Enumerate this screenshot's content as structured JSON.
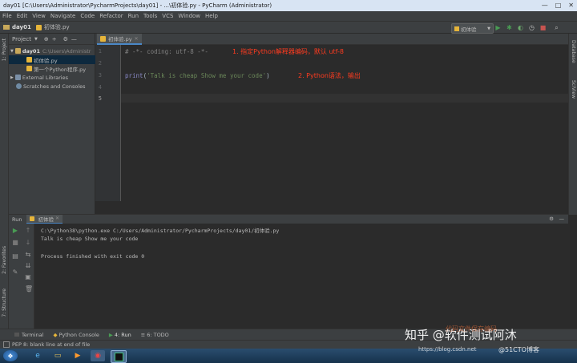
{
  "window": {
    "title": "day01 [C:\\Users\\Administrator\\PycharmProjects\\day01] - ...\\初体验.py - PyCharm (Administrator)",
    "controls": [
      "—",
      "□",
      "✕"
    ]
  },
  "menu": [
    "File",
    "Edit",
    "View",
    "Navigate",
    "Code",
    "Refactor",
    "Run",
    "Tools",
    "VCS",
    "Window",
    "Help"
  ],
  "breadcrumb": {
    "project": "day01",
    "file": "初体验.py"
  },
  "run_config": {
    "label": "初体验"
  },
  "left_tool_labels": {
    "project": "1: Project",
    "favorites": "2: Favorites",
    "structure": "7: Structure"
  },
  "right_tool_labels": {
    "database": "Database",
    "sciview": "SciView"
  },
  "project_panel": {
    "header_label": "Project",
    "tree": [
      {
        "label": "day01",
        "suffix": "C:\\Users\\Administr",
        "level": 0,
        "type": "folder",
        "expanded": true
      },
      {
        "label": "初体验.py",
        "level": 1,
        "type": "py",
        "selected": true
      },
      {
        "label": "第一个Python程序.py",
        "level": 1,
        "type": "py"
      },
      {
        "label": "External Libraries",
        "level": 0,
        "type": "lib"
      },
      {
        "label": "Scratches and Consoles",
        "level": 0,
        "type": "scratch"
      }
    ]
  },
  "editor": {
    "tab_label": "初体验.py",
    "line_numbers": [
      "1",
      "2",
      "3",
      "4",
      "5"
    ],
    "lines": [
      {
        "comment": "# -*- coding: utf-8 -*-"
      },
      {},
      {
        "func": "print",
        "open": "(",
        "string": "'Talk is cheap Show me your code'",
        "close": ")"
      },
      {},
      {}
    ],
    "annotations": [
      "1. 指定Python解释器编码，默认 utf-8",
      "2. Python语法，输出"
    ]
  },
  "run_panel": {
    "label": "Run",
    "tab_label": "初体验",
    "output": [
      "C:\\Python38\\python.exe C:/Users/Administrator/PycharmProjects/day01/初体验.py",
      "Talk is cheap Show me your code",
      "",
      "Process finished with exit code 0"
    ]
  },
  "bottom_tabs": [
    {
      "label": "Terminal"
    },
    {
      "label": "Python Console"
    },
    {
      "label": "4: Run"
    },
    {
      "label": "6: TODO"
    }
  ],
  "status": {
    "message": "PEP 8: blank line at end of file"
  },
  "watermark": {
    "main": "知乎 @软件测试阿沐",
    "sub": "https://blog.csdn.net",
    "sub2": "@51CTO博客",
    "faint": "代码文件保存编码"
  },
  "colors": {
    "comment": "#808080",
    "keyword_func": "#8888c6",
    "string": "#6a8759",
    "annotation": "#ff3b1f",
    "run_green": "#499c54",
    "selection": "#0d293e"
  }
}
